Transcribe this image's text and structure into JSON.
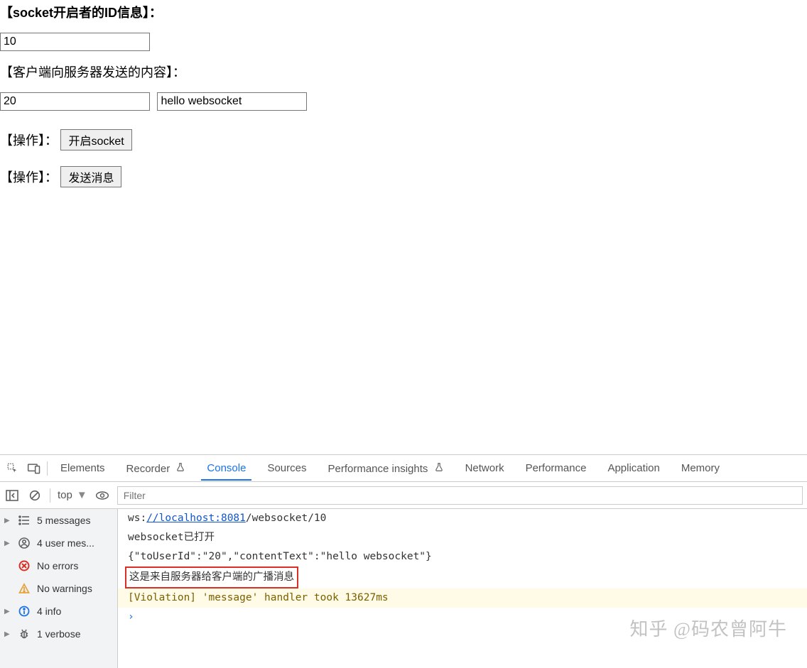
{
  "page": {
    "label_socket_id": "【socket开启者的ID信息】：",
    "input_socket_id": "10",
    "label_send_content": "【客户端向服务器发送的内容】：",
    "input_to_user": "20",
    "input_message": "hello websocket",
    "label_action1": "【操作】：",
    "btn_open_socket": "开启socket",
    "label_action2": "【操作】：",
    "btn_send_msg": "发送消息"
  },
  "devtools": {
    "tabs": {
      "elements": "Elements",
      "recorder": "Recorder",
      "console": "Console",
      "sources": "Sources",
      "perf_insights": "Performance insights",
      "network": "Network",
      "performance": "Performance",
      "application": "Application",
      "memory": "Memory"
    },
    "console_toolbar": {
      "context": "top",
      "filter_placeholder": "Filter"
    },
    "sidebar": {
      "messages": "5 messages",
      "user_messages": "4 user mes...",
      "no_errors": "No errors",
      "no_warnings": "No warnings",
      "info": "4 info",
      "verbose": "1 verbose"
    },
    "log": {
      "l1_prefix": "ws:",
      "l1_link": "//localhost:8081",
      "l1_suffix": "/websocket/10",
      "l2": "websocket已打开",
      "l3": "{\"toUserId\":\"20\",\"contentText\":\"hello websocket\"}",
      "l4": "这是来自服务器给客户端的广播消息",
      "l5": "[Violation] 'message' handler took 13627ms",
      "prompt": "›"
    }
  },
  "watermark": "知乎 @码农曾阿牛"
}
